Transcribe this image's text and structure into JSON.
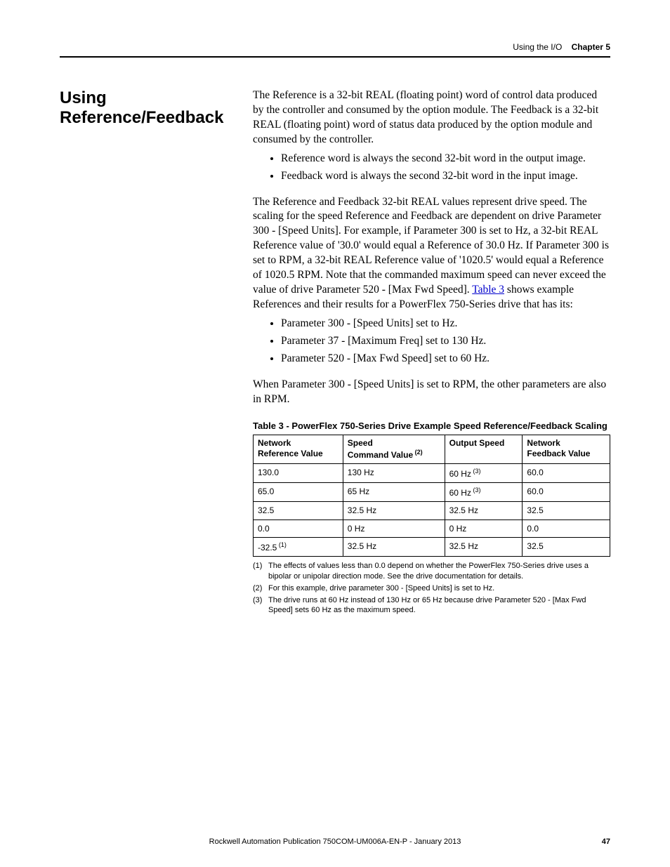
{
  "header": {
    "breadcrumb": "Using the I/O",
    "chapter": "Chapter 5"
  },
  "section_heading": "Using Reference/Feedback",
  "body": {
    "p1": "The Reference is a 32-bit REAL (floating point) word of control data produced by the controller and consumed by the option module. The Feedback is a 32-bit REAL (floating point) word of status data produced by the option module and consumed by the controller.",
    "b1": "Reference word is always the second 32-bit word in the output image.",
    "b2": "Feedback word is always the second 32-bit word in the input image.",
    "p2a": "The Reference and Feedback 32-bit REAL values represent drive speed. The scaling for the speed Reference and Feedback are dependent on drive Parameter 300 - [Speed Units]. For example, if Parameter 300 is set to Hz, a 32-bit REAL Reference value of '30.0' would equal a Reference of 30.0 Hz. If Parameter 300 is set to RPM, a 32-bit REAL Reference value of '1020.5' would equal a Reference of 1020.5 RPM. Note that the commanded maximum speed can never exceed the value of drive Parameter 520 - [Max Fwd Speed]. ",
    "p2_link": "Table 3",
    "p2b": " shows example References and their results for a PowerFlex 750-Series drive that has its:",
    "b3": "Parameter 300 - [Speed Units] set to Hz.",
    "b4": "Parameter 37 - [Maximum Freq] set to 130 Hz.",
    "b5": "Parameter 520 - [Max Fwd Speed] set to 60 Hz.",
    "p3": "When Parameter 300 - [Speed Units] is set to RPM, the other parameters are also in RPM."
  },
  "table": {
    "caption": "Table 3 - PowerFlex 750-Series Drive Example Speed Reference/Feedback Scaling",
    "headers": {
      "c1a": "Network",
      "c1b": "Reference Value",
      "c2a": "Speed",
      "c2b": "Command Value",
      "c2_sup": " (2)",
      "c3": "Output Speed",
      "c4a": "Network",
      "c4b": "Feedback Value"
    },
    "rows": [
      {
        "c1": "130.0",
        "c2": "130 Hz",
        "c3": "60 Hz",
        "c3_sup": " (3)",
        "c4": "60.0"
      },
      {
        "c1": "65.0",
        "c2": "65 Hz",
        "c3": "60 Hz",
        "c3_sup": " (3)",
        "c4": "60.0"
      },
      {
        "c1": "32.5",
        "c2": "32.5 Hz",
        "c3": "32.5 Hz",
        "c3_sup": "",
        "c4": "32.5"
      },
      {
        "c1": "0.0",
        "c2": "0 Hz",
        "c3": "0 Hz",
        "c3_sup": "",
        "c4": "0.0"
      },
      {
        "c1": "-32.5",
        "c1_sup": " (1)",
        "c2": "32.5 Hz",
        "c3": "32.5 Hz",
        "c3_sup": "",
        "c4": "32.5"
      }
    ]
  },
  "footnotes": {
    "f1_num": "(1)",
    "f1": "The effects of values less than 0.0 depend on whether the PowerFlex 750-Series drive uses a bipolar or unipolar direction mode. See the drive documentation for details.",
    "f2_num": "(2)",
    "f2": "For this example, drive parameter 300 - [Speed Units] is set to Hz.",
    "f3_num": "(3)",
    "f3": "The drive runs at 60 Hz instead of 130 Hz or 65 Hz because drive Parameter 520 - [Max Fwd Speed] sets 60 Hz as the maximum speed."
  },
  "footer": {
    "publication": "Rockwell Automation Publication 750COM-UM006A-EN-P - January 2013",
    "page": "47"
  }
}
